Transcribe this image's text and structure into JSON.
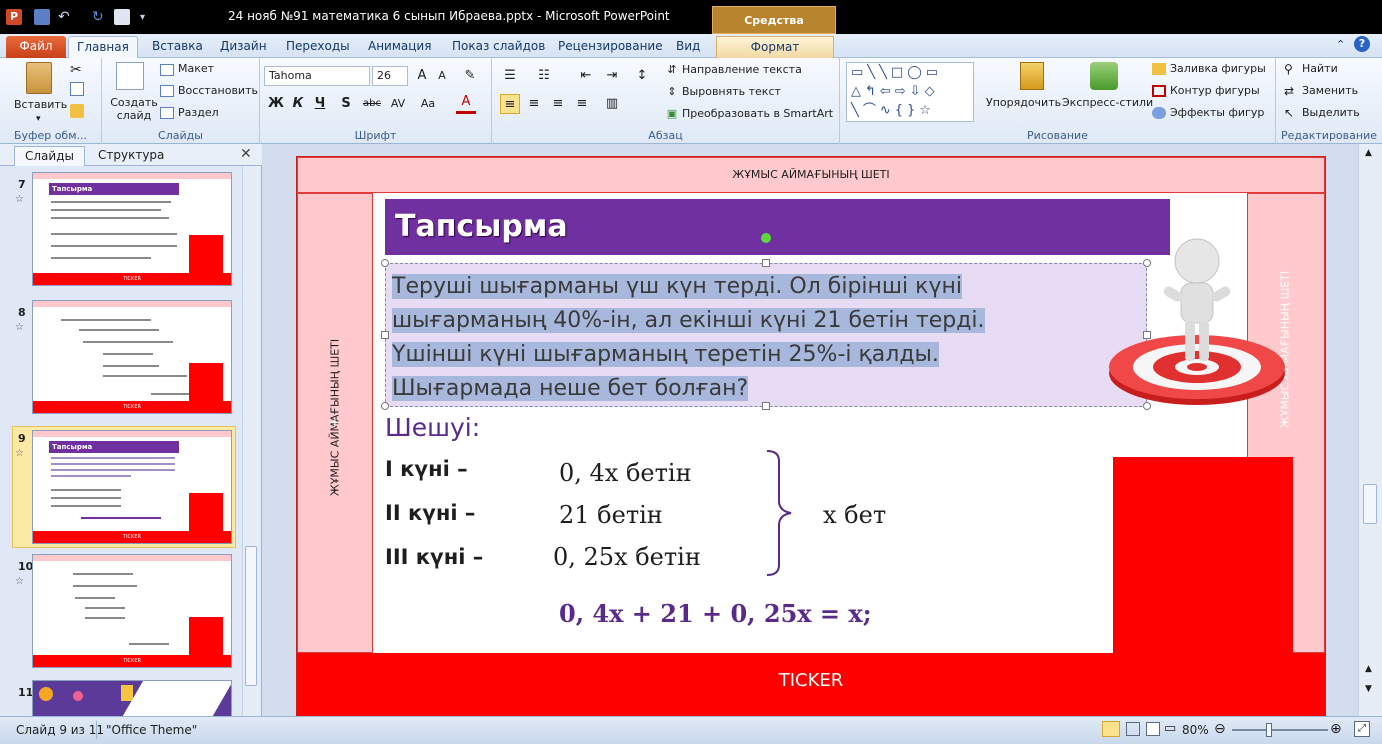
{
  "window": {
    "title": "24 нояб №91 математика 6 сынып Ибраева.pptx - Microsoft PowerPoint",
    "contextual_tab_header": "Средства рисования"
  },
  "tabs": [
    "Файл",
    "Главная",
    "Вставка",
    "Дизайн",
    "Переходы",
    "Анимация",
    "Показ слайдов",
    "Рецензирование",
    "Вид",
    "Формат"
  ],
  "ribbon": {
    "clipboard": {
      "paste": "Вставить",
      "label": "Буфер обм..."
    },
    "slides": {
      "new_slide": "Создать слайд",
      "layout": "Макет",
      "reset": "Восстановить",
      "section": "Раздел",
      "label": "Слайды"
    },
    "font": {
      "name": "Tahoma",
      "size": "26",
      "label": "Шрифт",
      "bold": "Ж",
      "italic": "К",
      "underline": "Ч",
      "shadow": "S",
      "strike": "abc"
    },
    "paragraph": {
      "text_direction": "Направление текста",
      "align_text": "Выровнять текст",
      "smartart": "Преобразовать в SmartArt",
      "label": "Абзац"
    },
    "drawing": {
      "arrange": "Упорядочить",
      "quick_styles": "Экспресс-стили",
      "fill": "Заливка фигуры",
      "outline": "Контур фигуры",
      "effects": "Эффекты фигур",
      "label": "Рисование"
    },
    "editing": {
      "find": "Найти",
      "replace": "Заменить",
      "select": "Выделить",
      "label": "Редактирование"
    }
  },
  "left_panel": {
    "tab_slides": "Слайды",
    "tab_outline": "Структура",
    "thumbnails": [
      {
        "num": "7",
        "title": "Тапсырма"
      },
      {
        "num": "8",
        "title": ""
      },
      {
        "num": "9",
        "title": "Тапсырма"
      },
      {
        "num": "10",
        "title": ""
      },
      {
        "num": "11",
        "title": ""
      }
    ]
  },
  "slide": {
    "top_label": "ЖҰМЫС АЙМАҒЫНЫҢ ШЕТІ",
    "left_label": "ЖҰМЫС АЙМАҒЫНЫҢ ШЕТІ",
    "right_label": "ЖҰМЫС АЙМАҒЫНЫҢ ШЕТІ",
    "ticker": "TICKER",
    "task_title": "Тапсырма",
    "problem_lines": [
      "Теруші шығарманы үш күн терді. Ол бірінші күні",
      "шығарманың 40%-ін, ал екінші күні 21 бетін терді.",
      "Үшінші күні шығарманың теретін 25%-і қалды.",
      "Шығармада неше бет болған?"
    ],
    "solution_header": "Шешуі:",
    "days": [
      {
        "label": "І күні –",
        "expr": "0, 4x бетін"
      },
      {
        "label": "ІІ күні –",
        "expr": "21 бетін"
      },
      {
        "label": "ІІІ күні –",
        "expr": "0, 25x бетін"
      }
    ],
    "total": "x бет",
    "equation": "0, 4x + 21 + 0, 25x  = x;"
  },
  "status": {
    "slide_info": "Слайд 9 из 11",
    "theme": "\"Office Theme\"",
    "zoom": "80%"
  },
  "colors": {
    "accent_purple": "#7030a0",
    "ticker_red": "#ff0000",
    "margin_pink": "#ffc9cd"
  }
}
